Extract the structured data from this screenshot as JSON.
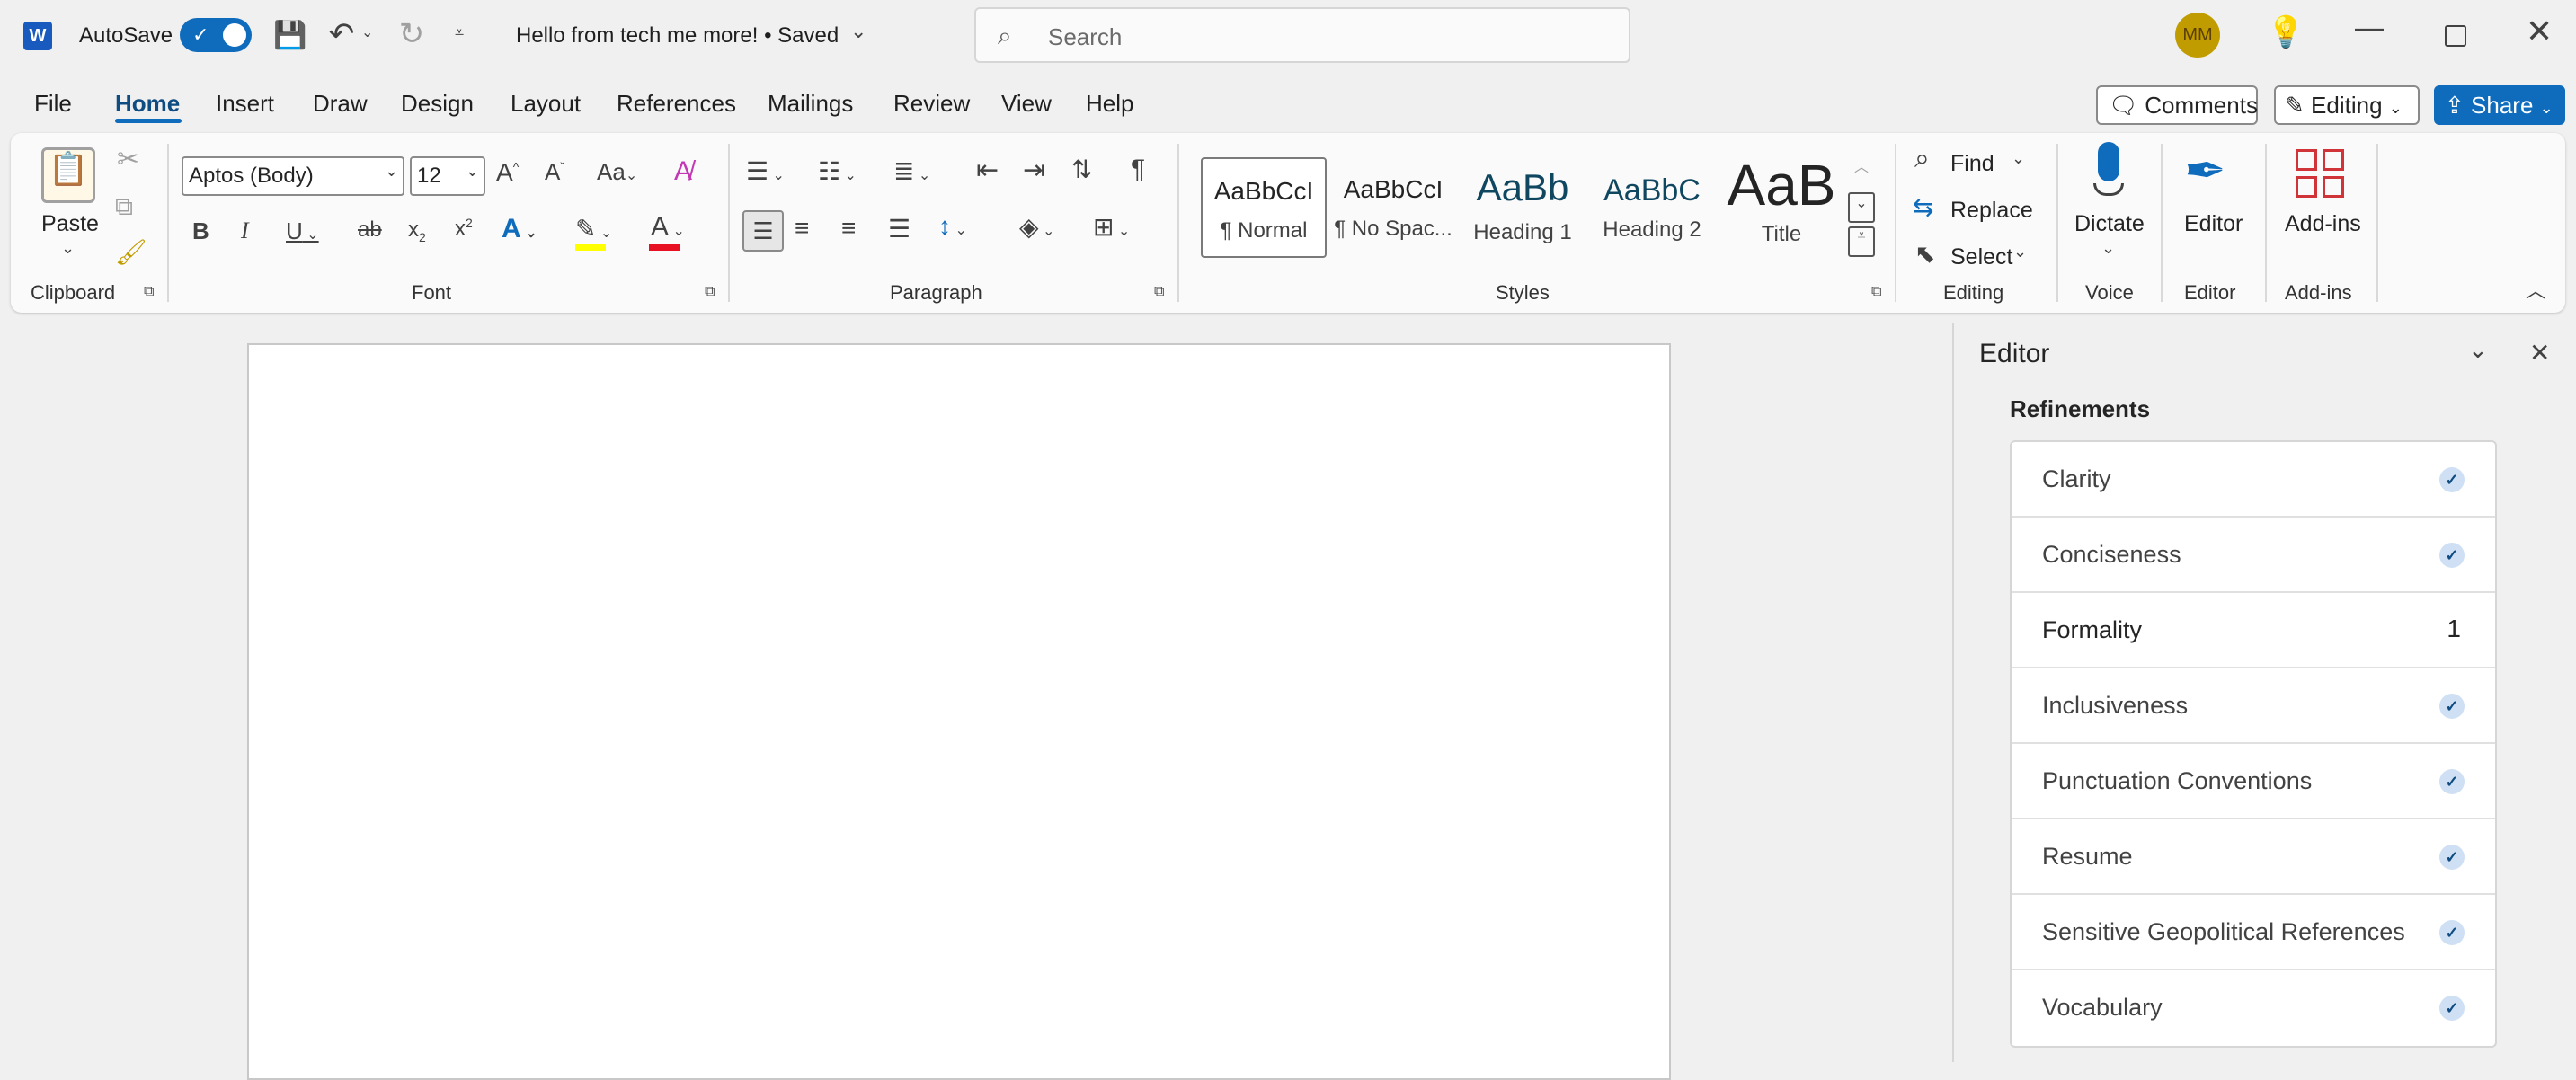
{
  "titlebar": {
    "autosave_label": "AutoSave",
    "doc_title": "Hello from tech me more! • Saved",
    "search_placeholder": "Search",
    "avatar_initials": "MM"
  },
  "menubar": {
    "tabs": [
      "File",
      "Home",
      "Insert",
      "Draw",
      "Design",
      "Layout",
      "References",
      "Mailings",
      "Review",
      "View",
      "Help"
    ],
    "active": "Home",
    "comments": "Comments",
    "editing": "Editing",
    "share": "Share"
  },
  "ribbon": {
    "clipboard": {
      "paste": "Paste",
      "label": "Clipboard"
    },
    "font": {
      "name": "Aptos (Body)",
      "size": "12",
      "label": "Font"
    },
    "paragraph": {
      "label": "Paragraph"
    },
    "styles": {
      "label": "Styles",
      "items": [
        {
          "preview": "AaBbCcI",
          "name": "¶ Normal"
        },
        {
          "preview": "AaBbCcI",
          "name": "¶ No Spac..."
        },
        {
          "preview": "AaBb",
          "name": "Heading 1"
        },
        {
          "preview": "AaBbC",
          "name": "Heading 2"
        },
        {
          "preview": "AaB",
          "name": "Title"
        }
      ]
    },
    "editing": {
      "find": "Find",
      "replace": "Replace",
      "select": "Select",
      "label": "Editing"
    },
    "voice": {
      "dictate": "Dictate",
      "label": "Voice"
    },
    "editor": {
      "button": "Editor",
      "label": "Editor"
    },
    "addins": {
      "button": "Add-ins",
      "label": "Add-ins"
    }
  },
  "editor_pane": {
    "title": "Editor",
    "refinements_title": "Refinements",
    "items": [
      {
        "label": "Clarity",
        "status": "check"
      },
      {
        "label": "Conciseness",
        "status": "check"
      },
      {
        "label": "Formality",
        "status": "count",
        "count": "1"
      },
      {
        "label": "Inclusiveness",
        "status": "check"
      },
      {
        "label": "Punctuation Conventions",
        "status": "check"
      },
      {
        "label": "Resume",
        "status": "check"
      },
      {
        "label": "Sensitive Geopolitical References",
        "status": "check"
      },
      {
        "label": "Vocabulary",
        "status": "check"
      }
    ]
  },
  "colors": {
    "accent": "#0f6cbd",
    "app_bg": "#f0f0f0",
    "highlight": "#ffff00",
    "font_color": "#e81123"
  }
}
